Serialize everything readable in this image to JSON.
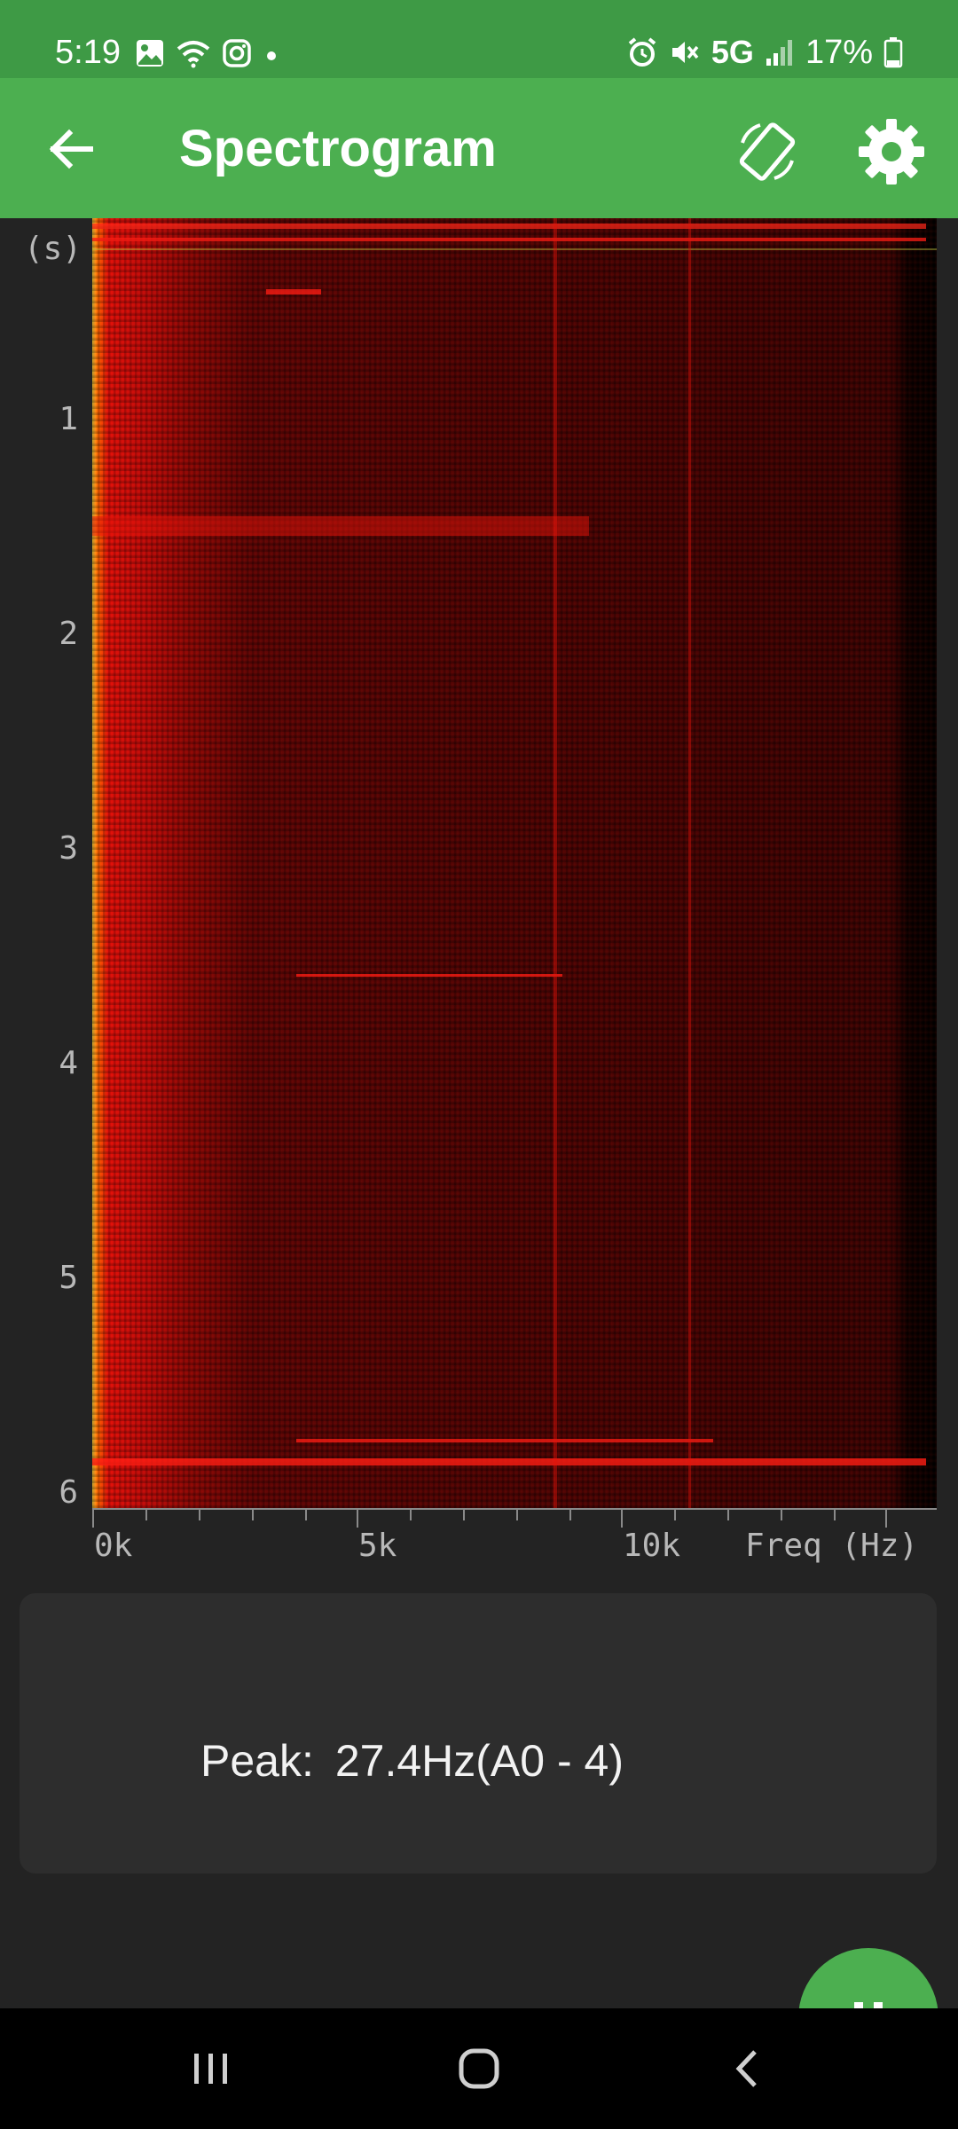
{
  "status_bar": {
    "time": "5:19",
    "network": "5G",
    "battery": "17%",
    "left_icons": [
      "gallery-icon",
      "wifi-icon",
      "instagram-icon",
      "dot-icon"
    ],
    "right_icons": [
      "alarm-icon",
      "mute-icon",
      "signal-icon",
      "battery-icon"
    ]
  },
  "app_bar": {
    "title": "Spectrogram",
    "icons": [
      "back-arrow-icon",
      "screen-rotate-icon",
      "gear-icon"
    ]
  },
  "spectrogram": {
    "time_unit": "(s)",
    "time_labels": [
      "1",
      "2",
      "3",
      "4",
      "5",
      "6"
    ],
    "freq_labels": [
      "0k",
      "5k",
      "10k"
    ],
    "freq_axis_label": "Freq (Hz)"
  },
  "peak": {
    "label": "Peak:",
    "value": "27.4Hz(A0 - 4)"
  },
  "fab": {
    "icon": "pause-icon"
  },
  "nav_bar": {
    "icons": [
      "recents-icon",
      "home-icon",
      "back-icon"
    ]
  },
  "colors": {
    "status_bar": "#3e9a45",
    "app_bar": "#4caf50",
    "background": "#232323",
    "panel": "#2d2d2d"
  }
}
